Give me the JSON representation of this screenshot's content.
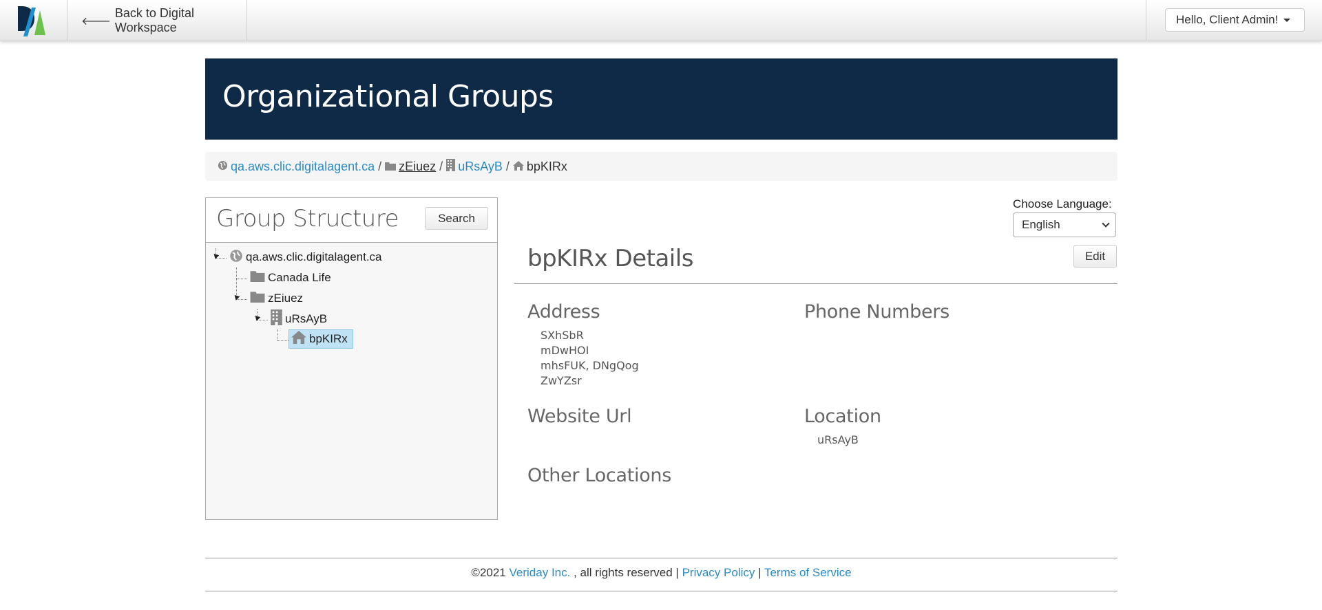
{
  "topbar": {
    "logo_alt": "DA",
    "back_label": "Back to Digital Workspace",
    "user_label": "Hello, Client Admin!"
  },
  "banner": {
    "title": "Organizational Groups"
  },
  "breadcrumb": {
    "items": [
      {
        "label": "qa.aws.clic.digitalagent.ca",
        "icon": "globe-icon"
      },
      {
        "label": "zEiuez",
        "icon": "folder-icon"
      },
      {
        "label": "uRsAyB",
        "icon": "building-icon"
      },
      {
        "label": "bpKIRx",
        "icon": "home-icon"
      }
    ],
    "separator": "/"
  },
  "group_structure": {
    "title": "Group Structure",
    "search_label": "Search",
    "tree": [
      {
        "label": "qa.aws.clic.digitalagent.ca",
        "icon": "globe-icon",
        "level": 0
      },
      {
        "label": "Canada Life",
        "icon": "folder-icon",
        "level": 1
      },
      {
        "label": "zEiuez",
        "icon": "folder-icon",
        "level": 1
      },
      {
        "label": "uRsAyB",
        "icon": "building-icon",
        "level": 2
      },
      {
        "label": "bpKIRx",
        "icon": "home-icon",
        "level": 3,
        "selected": true
      }
    ]
  },
  "language": {
    "label": "Choose Language:",
    "selected": "English"
  },
  "details": {
    "title": "bpKIRx Details",
    "edit_label": "Edit",
    "address": {
      "heading": "Address",
      "lines": [
        "SXhSbR",
        "mDwHOI",
        "mhsFUK, DNgQog",
        "ZwYZsr"
      ]
    },
    "phone": {
      "heading": "Phone Numbers"
    },
    "website": {
      "heading": "Website Url"
    },
    "location": {
      "heading": "Location",
      "value": "uRsAyB"
    },
    "other_locations": {
      "heading": "Other Locations"
    }
  },
  "footer": {
    "copyright": "©2021",
    "company": "Veriday Inc.",
    "rights": ", all rights reserved |",
    "privacy": "Privacy Policy",
    "divider": "|",
    "terms": "Terms of Service"
  },
  "colors": {
    "banner_bg": "#0e2a47",
    "link": "#2a8bc4",
    "selected_bg": "#bfe3f5"
  }
}
